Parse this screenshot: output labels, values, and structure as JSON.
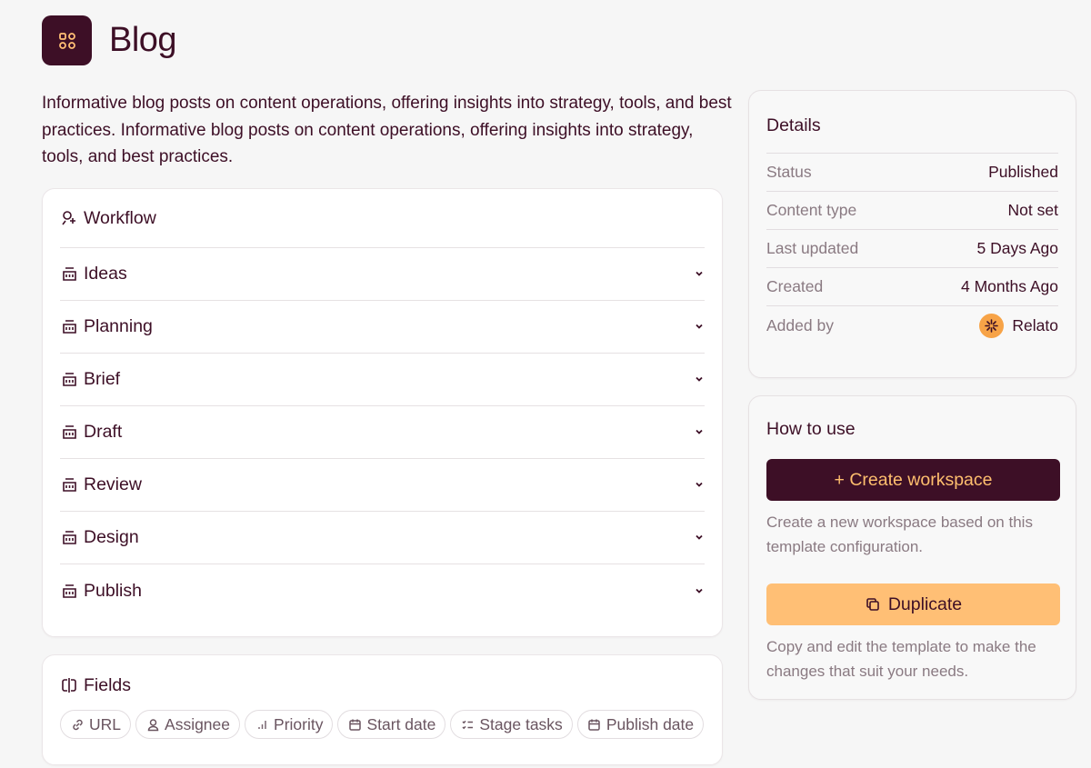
{
  "header": {
    "title": "Blog",
    "icon": "template-grid-icon"
  },
  "description": "Informative blog posts on content operations, offering insights into strategy, tools, and best practices. Informative blog posts on content operations, offering insights into strategy, tools, and best practices.",
  "workflow": {
    "title": "Workflow",
    "stages": [
      {
        "label": "Ideas"
      },
      {
        "label": "Planning"
      },
      {
        "label": "Brief"
      },
      {
        "label": "Draft"
      },
      {
        "label": "Review"
      },
      {
        "label": "Design"
      },
      {
        "label": "Publish"
      }
    ]
  },
  "fields": {
    "title": "Fields",
    "items": [
      {
        "label": "URL",
        "icon": "link-icon"
      },
      {
        "label": "Assignee",
        "icon": "user-icon"
      },
      {
        "label": "Priority",
        "icon": "priority-bars-icon"
      },
      {
        "label": "Start date",
        "icon": "calendar-icon"
      },
      {
        "label": "Stage tasks",
        "icon": "checklist-icon"
      },
      {
        "label": "Publish date",
        "icon": "calendar-icon"
      }
    ]
  },
  "details": {
    "title": "Details",
    "rows": [
      {
        "label": "Status",
        "value": "Published"
      },
      {
        "label": "Content type",
        "value": "Not set"
      },
      {
        "label": "Last updated",
        "value": "5 Days Ago"
      },
      {
        "label": "Created",
        "value": "4 Months Ago"
      },
      {
        "label": "Added by",
        "value": "Relato"
      }
    ]
  },
  "howto": {
    "title": "How to use",
    "create_label": "+ Create workspace",
    "create_help": "Create a new workspace based on this template configuration.",
    "duplicate_label": "Duplicate",
    "duplicate_help": "Copy and edit the template to make the changes that suit your needs."
  },
  "colors": {
    "brand": "#3d0f26",
    "accent": "#ffbf75",
    "muted": "#8a7a82"
  }
}
